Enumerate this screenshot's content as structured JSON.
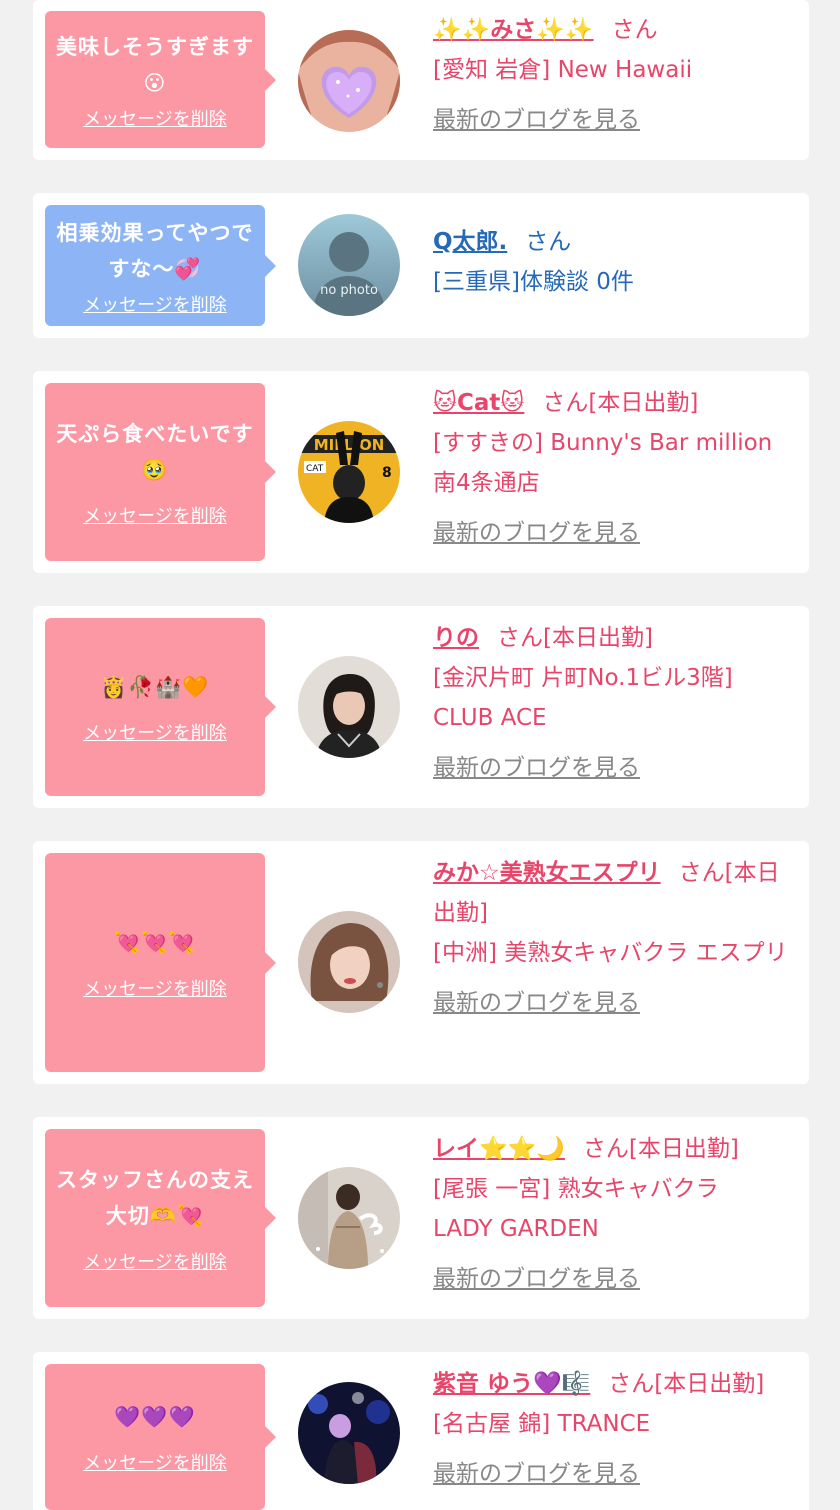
{
  "colors": {
    "pink_bubble": "#fc97a4",
    "blue_bubble": "#8db5f6",
    "pink_text": "#e8456b",
    "blue_text": "#2569b8",
    "gray_link": "#888888"
  },
  "labels": {
    "delete_message": "メッセージを削除",
    "latest_blog": "最新のブログを見る"
  },
  "items": [
    {
      "message": "美味しそうすぎます😮",
      "name": "✨✨みさ✨✨",
      "honorific": "さん",
      "shop": "[愛知 岩倉] New Hawaii",
      "avatar_icon": "heart-face-photo"
    },
    {
      "message": "相乗効果ってやつですな〜💞",
      "name": "Q太郎.",
      "honorific": "さん",
      "shop": "[三重県]体験談 0件",
      "avatar_icon": "no-photo-silhouette",
      "avatar_text": "no photo"
    },
    {
      "message": "天ぷら食べたいです🥹",
      "name": "🐱Cat🐱",
      "honorific": "さん[本日出勤]",
      "shop": "[すすきの] Bunny's Bar million 南4条通店",
      "avatar_icon": "bunny-ears-photo"
    },
    {
      "message": "👸🥀🏰🧡",
      "name": "りの",
      "honorific": "さん[本日出勤]",
      "shop": "[金沢片町 片町No.1ビル3階] CLUB ACE",
      "avatar_icon": "woman-portrait-photo"
    },
    {
      "message": "💘💘💘",
      "name": "みか☆美熟女エスプリ",
      "honorific": "さん[本日出勤]",
      "shop": "[中洲] 美熟女キャバクラ エスプリ",
      "avatar_icon": "woman-selfie-photo"
    },
    {
      "message": "スタッフさんの支え大切🫶💘",
      "name": "レイ⭐⭐🌙",
      "honorific": "さん[本日出勤]",
      "shop": "[尾張 一宮] 熟女キャバクラ LADY GARDEN",
      "avatar_icon": "dress-back-photo"
    },
    {
      "message": "💜💜💜",
      "name": "紫音 ゆう💜🎼",
      "honorific": "さん[本日出勤]",
      "shop": "[名古屋 錦] TRANCE",
      "avatar_icon": "night-party-photo"
    }
  ]
}
